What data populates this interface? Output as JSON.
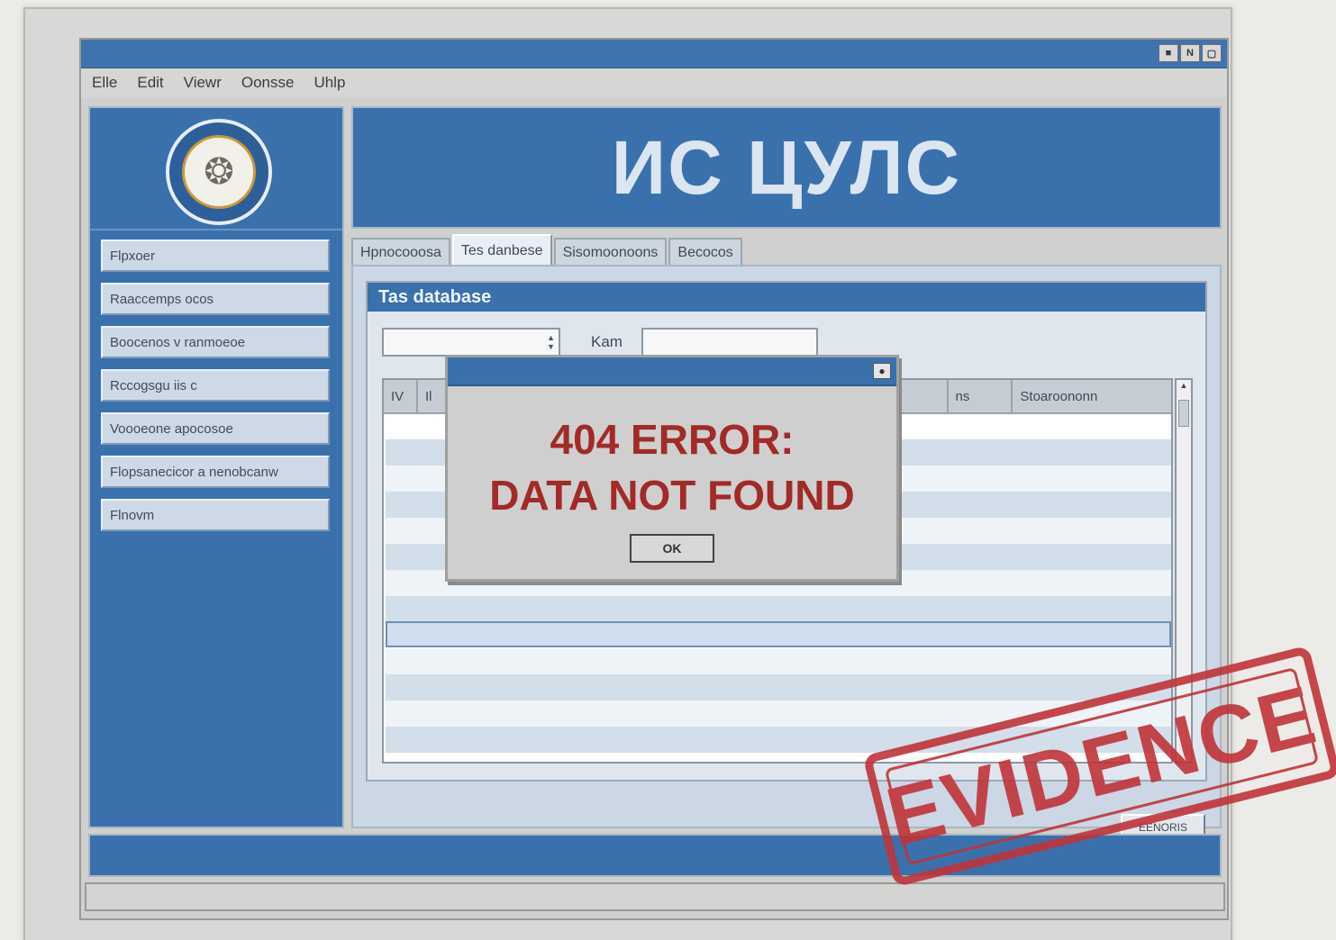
{
  "window": {
    "controls": [
      "■",
      "N",
      "▢"
    ]
  },
  "menu": [
    "Elle",
    "Edit",
    "Viewr",
    "Oonsse",
    "Uhlp"
  ],
  "banner": {
    "title": "ИС ЦУЛС"
  },
  "sidebar": {
    "items": [
      "Flpxoer",
      "Raaccemps ocos",
      "Boocenos v ranmoeoe",
      "Rccogsgu iis c",
      "Voooeone apocosoe",
      "Flopsanecicor a nenobcanw",
      "Flnovm"
    ]
  },
  "tabs": [
    "Hpnocooosa",
    "Tes danbese",
    "Sisomoonoons",
    "Becocos"
  ],
  "panel": {
    "title": "Tas database",
    "field_label": "Kam",
    "columns": [
      "IV",
      "Il",
      "ns",
      "Stoaroononn"
    ],
    "action_button": "EENORIS"
  },
  "dialog": {
    "line1": "404 ERROR:",
    "line2": "DATA NOT FOUND",
    "ok_label": "OK"
  },
  "stamp": {
    "text": "EVIDENCE"
  },
  "colors": {
    "accent": "#3a71ad",
    "error": "#a22a27",
    "stamp": "#c0343a"
  }
}
